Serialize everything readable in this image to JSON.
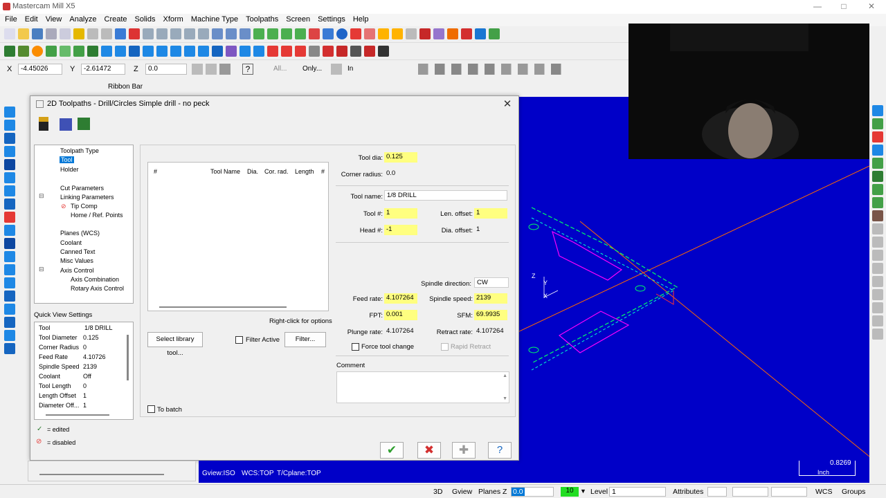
{
  "window": {
    "title": "Mastercam Mill X5"
  },
  "menu": [
    "File",
    "Edit",
    "View",
    "Analyze",
    "Create",
    "Solids",
    "Xform",
    "Machine Type",
    "Toolpaths",
    "Screen",
    "Settings",
    "Help"
  ],
  "coords": {
    "x_label": "X",
    "x_value": "-4.45026",
    "y_label": "Y",
    "y_value": "-2.61472",
    "z_label": "Z",
    "z_value": "0.0",
    "all": "All...",
    "only": "Only...",
    "unit": "In"
  },
  "ribbon": {
    "label": "Ribbon Bar"
  },
  "dialog": {
    "title": "2D Toolpaths - Drill/Circles Simple drill - no peck",
    "tree": [
      {
        "label": "Toolpath Type"
      },
      {
        "label": "Tool",
        "selected": true
      },
      {
        "label": "Holder"
      },
      {
        "label": "Cut Parameters"
      },
      {
        "label": "Linking Parameters"
      },
      {
        "label": "Tip Comp"
      },
      {
        "label": "Home / Ref. Points"
      },
      {
        "label": "Planes (WCS)"
      },
      {
        "label": "Coolant"
      },
      {
        "label": "Canned Text"
      },
      {
        "label": "Misc Values"
      },
      {
        "label": "Axis Control"
      },
      {
        "label": "Axis Combination"
      },
      {
        "label": "Rotary Axis Control"
      }
    ],
    "quick_view": {
      "title": "Quick View Settings",
      "rows": [
        {
          "k": "Tool",
          "v": "1/8 DRILL"
        },
        {
          "k": "Tool Diameter",
          "v": "0.125"
        },
        {
          "k": "Corner Radius",
          "v": "0"
        },
        {
          "k": "Feed Rate",
          "v": "4.10726"
        },
        {
          "k": "Spindle Speed",
          "v": "2139"
        },
        {
          "k": "Coolant",
          "v": "Off"
        },
        {
          "k": "Tool Length",
          "v": "0"
        },
        {
          "k": "Length Offset",
          "v": "1"
        },
        {
          "k": "Diameter Off...",
          "v": "1"
        }
      ]
    },
    "legend": {
      "edited": "= edited",
      "disabled": "= disabled"
    },
    "tool_table": {
      "columns": [
        "#",
        "Tool Name",
        "Dia.",
        "Cor. rad.",
        "Length",
        "#"
      ]
    },
    "right_click": "Right-click for options",
    "select_library": "Select library tool...",
    "filter_active": "Filter Active",
    "filter": "Filter...",
    "to_batch": "To batch",
    "fields": {
      "tool_dia_label": "Tool dia:",
      "tool_dia": "0.125",
      "corner_radius_label": "Corner radius:",
      "corner_radius": "0.0",
      "tool_name_label": "Tool name:",
      "tool_name": "1/8 DRILL",
      "tool_num_label": "Tool #:",
      "tool_num": "1",
      "len_offset_label": "Len. offset:",
      "len_offset": "1",
      "head_label": "Head #:",
      "head": "-1",
      "dia_offset_label": "Dia. offset:",
      "dia_offset": "1",
      "spindle_dir_label": "Spindle direction:",
      "spindle_dir": "CW",
      "feed_rate_label": "Feed rate:",
      "feed_rate": "4.107264",
      "spindle_speed_label": "Spindle speed:",
      "spindle_speed": "2139",
      "fpt_label": "FPT:",
      "fpt": "0.001",
      "sfm_label": "SFM:",
      "sfm": "69.9935",
      "plunge_rate_label": "Plunge rate:",
      "plunge_rate": "4.107264",
      "retract_rate_label": "Retract rate:",
      "retract_rate": "4.107264",
      "force_tool_change": "Force tool change",
      "rapid_retract": "Rapid Retract",
      "comment_label": "Comment"
    }
  },
  "viewport": {
    "status": {
      "gview": "Gview:ISO",
      "wcs": "WCS:TOP",
      "tplane": "T/Cplane:TOP"
    },
    "scale_value": "0.8269",
    "scale_unit": "Inch",
    "axis_z": "Z",
    "axis_y": "Y",
    "axis_x": "X"
  },
  "statusbar": {
    "view3d": "3D",
    "gview": "Gview",
    "planes": "Planes",
    "z_label": "Z",
    "z_value": "0.0",
    "color": "10",
    "level_label": "Level",
    "level_value": "1",
    "attributes": "Attributes",
    "wcs": "WCS",
    "groups": "Groups"
  },
  "colors": {
    "viewport_bg": "#0000c8",
    "field_yellow": "#ffff80",
    "accent": "#0078d7"
  }
}
